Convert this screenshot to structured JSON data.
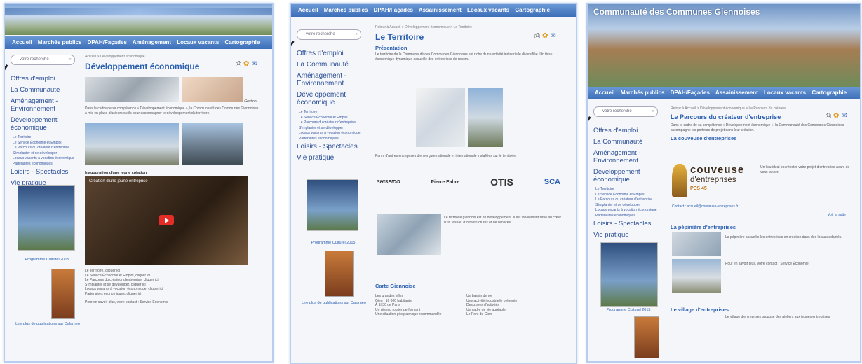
{
  "shot1": {
    "nav": [
      "Accueil",
      "Marchés publics",
      "DPAH/Façades",
      "Aménagement",
      "Locaux vacants",
      "Cartographie"
    ],
    "search_placeholder": "votre recherche",
    "menu": [
      "Offres d'emploi",
      "La Communauté",
      "Aménagement - Environnement",
      "Développement économique"
    ],
    "submenu": [
      "Le Territoire",
      "Le Service Économie et Emploi",
      "Le Parcours du créateur d'entreprise",
      "S'implanter et se développer",
      "Locaux vacants à vocation économique",
      "Partenaires économiques"
    ],
    "menu_bottom": [
      "Loisirs - Spectacles",
      "Vie pratique"
    ],
    "breadcrumb": "Accueil > Développement économique",
    "title": "Développement économique",
    "photo_caption": "Gestion",
    "intro": "Dans le cadre de sa compétence « Développement économique », la Communauté des Communes Giennoises a mis en place plusieurs outils pour accompagner le développement du territoire.",
    "video_heading": "Inauguration d'une jeune création",
    "video_title": "Création d'une jeune entreprise",
    "links": [
      "Le Territoire, cliquer ici",
      "Le Service Économie et Emploi, cliquer ici",
      "Le Parcours du créateur d'entreprise, cliquer ici",
      "S'implanter et se développer, cliquer ici",
      "Locaux vacants à vocation économique, cliquer ici",
      "Partenaires économiques, cliquer ici"
    ],
    "contact": "Pour en savoir plus, votre contact : Service Économie",
    "programme_caption": "Programme Culturel 2015",
    "publications_caption": "Lire plus de publications sur Calameo"
  },
  "shot2": {
    "nav": [
      "Accueil",
      "Marchés publics",
      "DPAH/Façades",
      "Assainissement",
      "Locaux vacants",
      "Cartographie"
    ],
    "search_placeholder": "votre recherche",
    "menu": [
      "Offres d'emploi",
      "La Communauté",
      "Aménagement - Environnement",
      "Développement économique"
    ],
    "submenu": [
      "Le Territoire",
      "Le Service Économie et Emploi",
      "Le Parcours du créateur d'entreprise",
      "S'implanter et se développer",
      "Locaux vacants à vocation économique",
      "Partenaires économiques"
    ],
    "menu_bottom": [
      "Loisirs - Spectacles",
      "Vie pratique"
    ],
    "breadcrumb": "Retour à Accueil > Développement économique > Le Territoire",
    "title": "Le Territoire",
    "subheading": "Présentation",
    "intro": "Le territoire de la Communauté des Communes Giennoises est riche d'une activité industrielle diversifiée. Un tissu économique dynamique accueille des entreprises de renom.",
    "para2": "Parmi d'autres entreprises d'envergure nationale et internationale installées sur le territoire.",
    "logos": [
      "SHISEIDO",
      "Pierre Fabre",
      "OTIS",
      "SCA"
    ],
    "para3": "Le territoire giennois est en développement. Il est idéalement situé au cœur d'un réseau d'infrastructures et de services.",
    "section_heading": "Carte Giennoise",
    "programme_caption": "Programme Culturel 2015",
    "publications_caption": "Lire plus de publications sur Calameo",
    "col_left": [
      "Les grandes villes",
      "Gien : 16 000 habitants",
      "À 1h30 de Paris",
      "Un réseau routier performant",
      "Une situation géographique recommandée"
    ],
    "col_right": [
      "Un bassin de vie",
      "Une activité industrielle présente",
      "Des zones d'activités",
      "Un cadre de vie agréable",
      "Le Pont de Gien"
    ]
  },
  "shot3": {
    "banner_title": "Communauté des Communes Giennoises",
    "nav": [
      "Accueil",
      "Marchés publics",
      "DPAH/Façades",
      "Assainissement",
      "Locaux vacants",
      "Cartographie"
    ],
    "search_placeholder": "votre recherche",
    "menu": [
      "Offres d'emploi",
      "La Communauté",
      "Aménagement - Environnement",
      "Développement économique"
    ],
    "submenu": [
      "Le Territoire",
      "Le Service Économie et Emploi",
      "Le Parcours du créateur d'entreprise",
      "S'implanter et se développer",
      "Locaux vacants à vocation économique",
      "Partenaires économiques"
    ],
    "menu_bottom": [
      "Loisirs - Spectacles",
      "Vie pratique"
    ],
    "breadcrumb": "Retour à Accueil > Développement économique > Le Parcours du créateur",
    "title": "Le Parcours du créateur d'entreprise",
    "intro": "Dans le cadre de sa compétence « Développement économique », la Communauté des Communes Giennoises accompagne les porteurs de projet dans leur création.",
    "section1": "La couveuse d'entreprises",
    "couveuse_big": "couveuse",
    "couveuse_sub": "d'entreprises",
    "couveuse_tag": "PES 45",
    "couveuse_text": "Un lieu idéal pour tester votre projet d'entreprise avant de vous lancer.",
    "contact_line": "Contact : accueil@couveuse-entreprises.fr",
    "section2": "La pépinière d'entreprises",
    "pepiniere_text": "La pépinière accueille les entreprises en création dans des locaux adaptés.",
    "section3": "Le village d'entreprises",
    "village_text": "Le village d'entreprises propose des ateliers aux jeunes entreprises.",
    "contact": "Pour en savoir plus, votre contact : Service Économie",
    "programme_caption": "Programme Culturel 2015",
    "read_more": "Voir la suite"
  },
  "colors": {
    "accent": "#2a5fb0",
    "nav": "#3d6fb8",
    "border": "#b9cdf0"
  }
}
